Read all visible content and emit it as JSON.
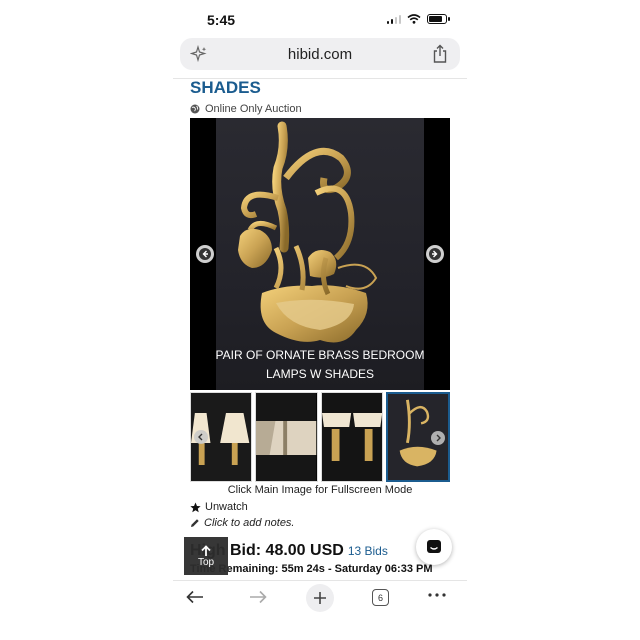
{
  "status_bar": {
    "time": "5:45",
    "battery_level": 0.8
  },
  "browser": {
    "url": "hibid.com"
  },
  "page": {
    "title": "SHADES",
    "auction_type": "Online Only Auction"
  },
  "main_image": {
    "caption": "PAIR OF ORNATE BRASS BEDROOM LAMPS W SHADES"
  },
  "thumbnails": {
    "count": 4,
    "active_index": 3
  },
  "fullscreen_note": "Click Main Image for Fullscreen Mode",
  "actions": {
    "unwatch_label": "Unwatch",
    "notes_label": "Click to add notes."
  },
  "bid": {
    "label": "High Bid: 48.00 USD",
    "bids_link": "13 Bids",
    "time_remaining": "Time Remaining: 55m 24s - Saturday 06:33 PM"
  },
  "top_button": {
    "label": "Top"
  },
  "bottom_bar": {
    "tab_count": "6"
  },
  "colors": {
    "accent": "#1b5c8f",
    "image_bg": "#000000",
    "brass": "#c9a253"
  }
}
